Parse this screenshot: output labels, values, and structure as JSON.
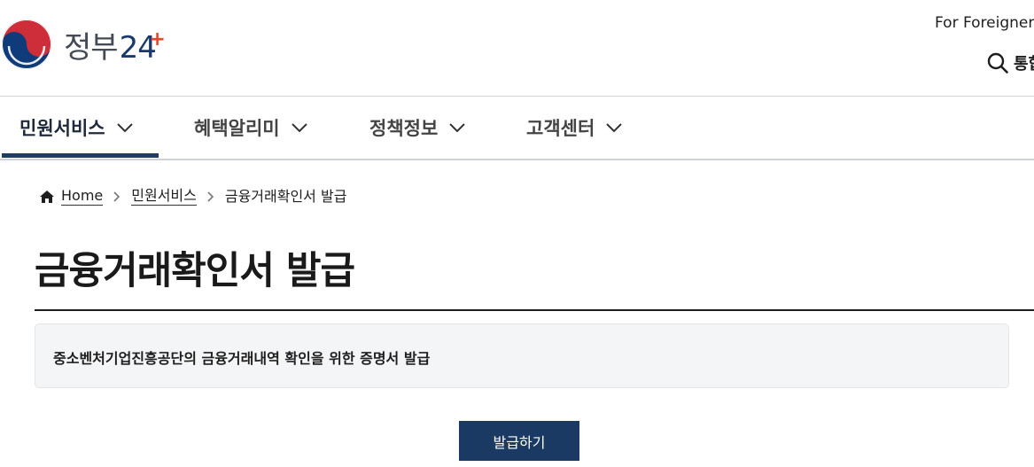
{
  "header": {
    "logo_ko": "정부",
    "logo_num": "24",
    "logo_plus": "+",
    "foreigner_link": "For Foreigner",
    "search_label": "통합"
  },
  "nav": {
    "items": [
      {
        "label": "민원서비스",
        "active": true
      },
      {
        "label": "혜택알리미",
        "active": false
      },
      {
        "label": "정책정보",
        "active": false
      },
      {
        "label": "고객센터",
        "active": false
      }
    ]
  },
  "breadcrumb": {
    "home": "Home",
    "level1": "민원서비스",
    "current": "금융거래확인서 발급"
  },
  "page": {
    "title": "금융거래확인서 발급",
    "description": "중소벤처기업진흥공단의 금융거래내역 확인을 위한 증명서 발급",
    "issue_button": "발급하기"
  },
  "colors": {
    "primary": "#1b3a63",
    "active_underline": "#1f3b66",
    "emblem_red": "#cd2e3a",
    "emblem_blue": "#0f3b7a",
    "plus_accent": "#e4472b"
  }
}
